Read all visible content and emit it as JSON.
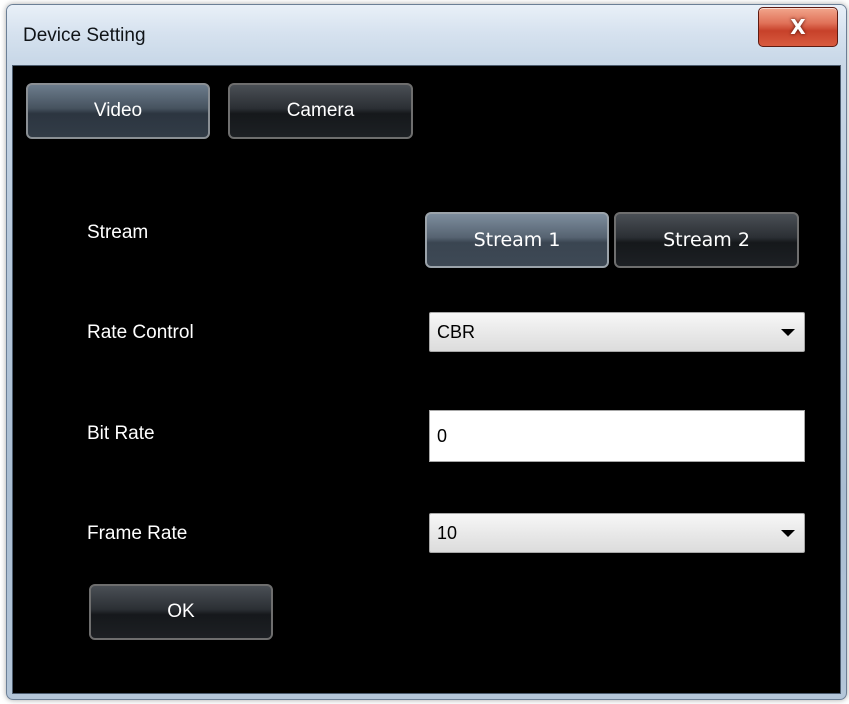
{
  "window": {
    "title": "Device Setting",
    "close_label": "X"
  },
  "tabs": [
    {
      "label": "Video",
      "active": true
    },
    {
      "label": "Camera",
      "active": false
    }
  ],
  "stream": {
    "label": "Stream",
    "options": [
      {
        "label": "Stream 1",
        "active": true
      },
      {
        "label": "Stream 2",
        "active": false
      }
    ]
  },
  "rate_control": {
    "label": "Rate Control",
    "value": "CBR"
  },
  "bit_rate": {
    "label": "Bit Rate",
    "value": "0"
  },
  "frame_rate": {
    "label": "Frame Rate",
    "value": "10"
  },
  "ok_label": "OK",
  "colors": {
    "client_background": "#000000",
    "close_button": "#c7412a",
    "button_text": "#ffffff"
  }
}
